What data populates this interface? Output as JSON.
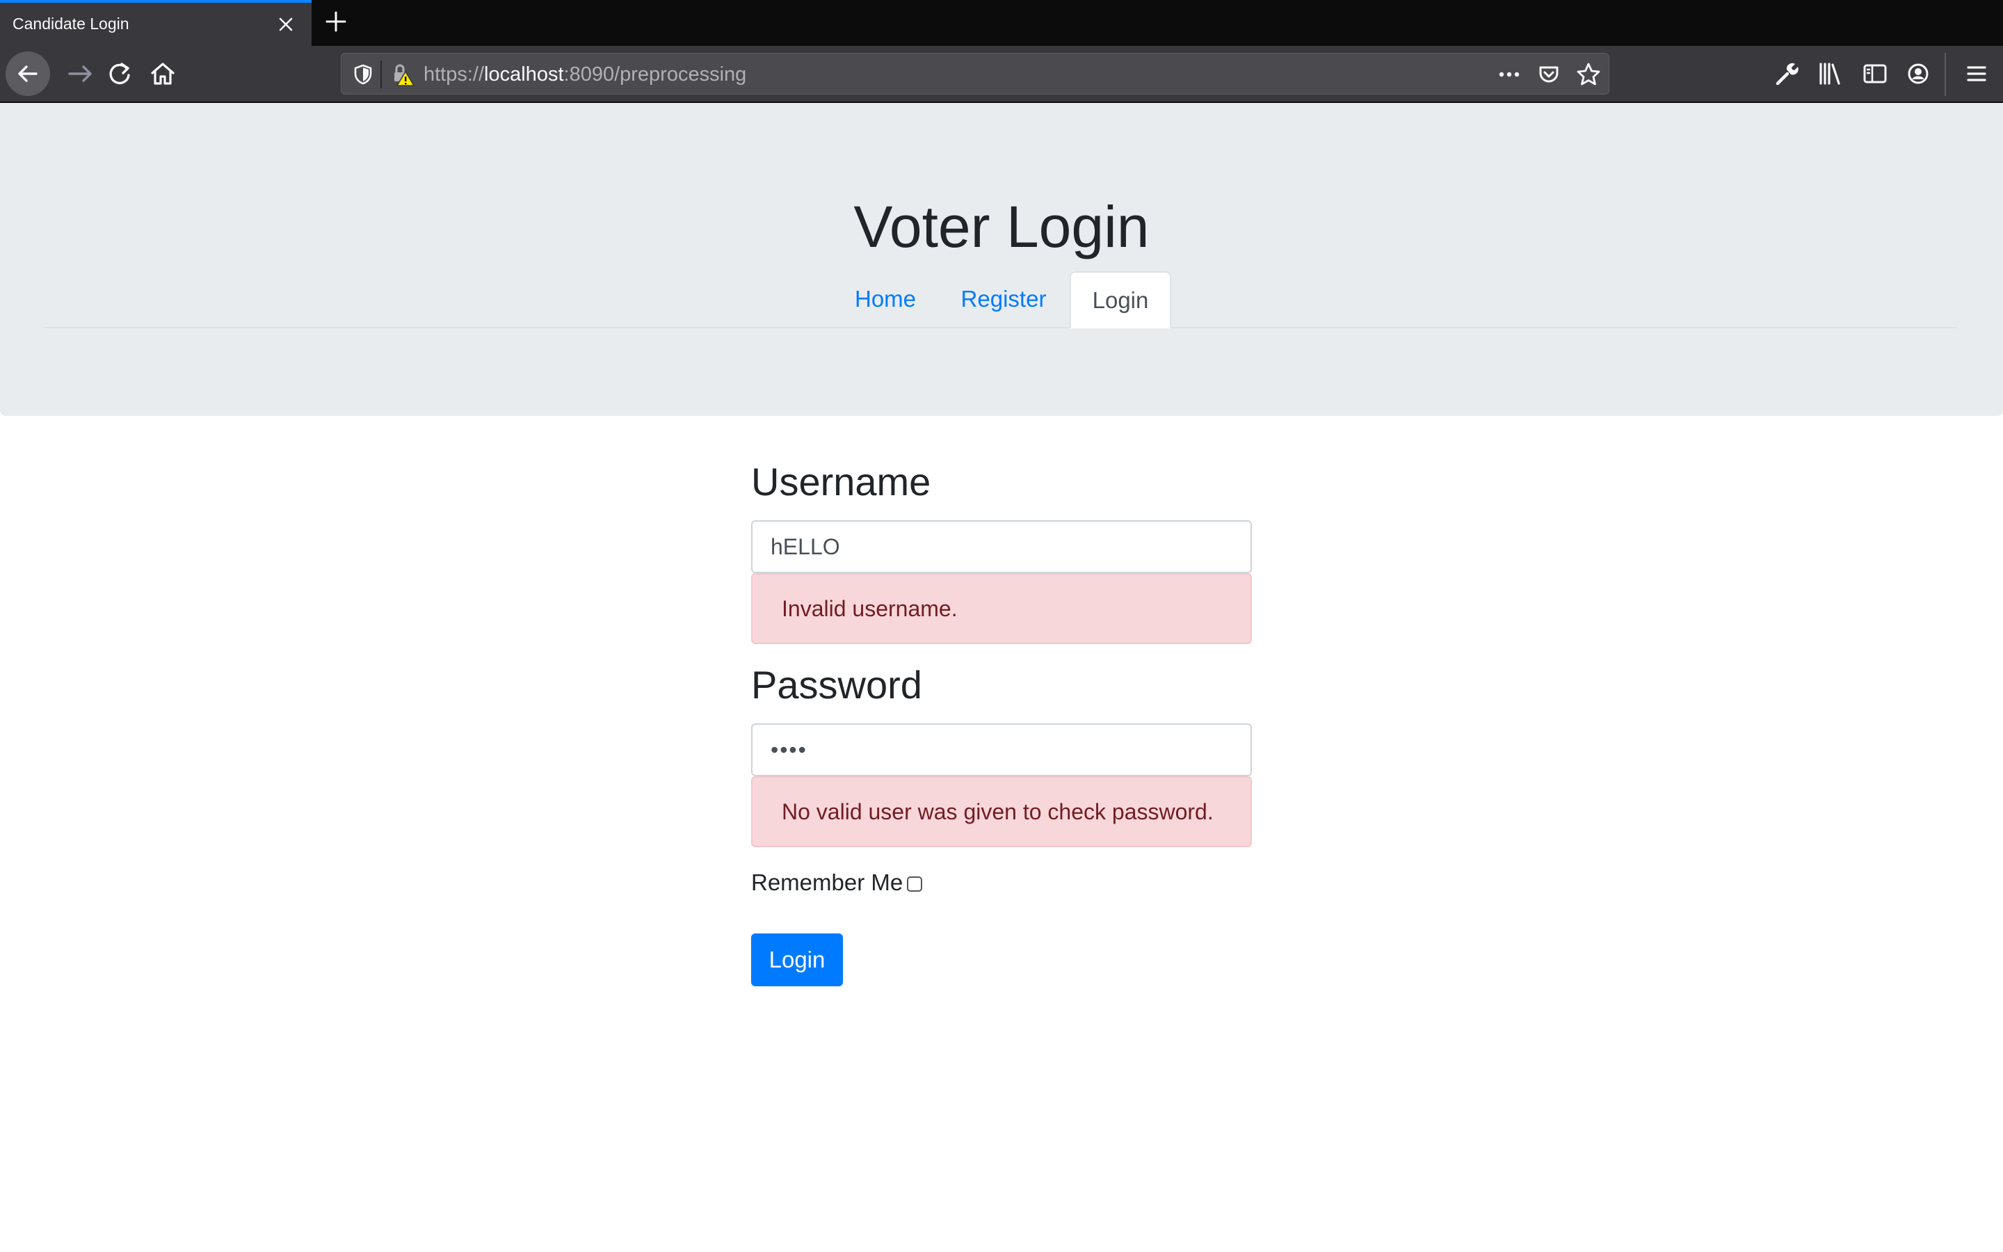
{
  "browser": {
    "tab_title": "Candidate Login",
    "url_scheme": "https://",
    "url_host": "localhost",
    "url_rest": ":8090/preprocessing"
  },
  "page": {
    "title": "Voter Login",
    "nav": [
      {
        "label": "Home"
      },
      {
        "label": "Register"
      },
      {
        "label": "Login",
        "active": true
      }
    ]
  },
  "form": {
    "username_label": "Username",
    "username_value": "hELLO",
    "username_error": "Invalid username.",
    "password_label": "Password",
    "password_value": "••••",
    "password_error": "No valid user was given to check password.",
    "remember_label": "Remember Me",
    "remember_checked": false,
    "submit_label": "Login"
  },
  "colors": {
    "accent": "#007bff",
    "jumbotron_bg": "#e9ecef",
    "alert_bg": "#f8d7da",
    "alert_text": "#721c24"
  }
}
